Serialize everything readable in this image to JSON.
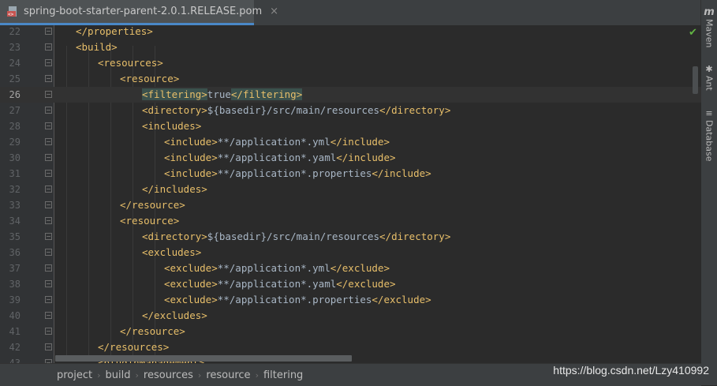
{
  "tab": {
    "title": "spring-boot-starter-parent-2.0.1.RELEASE.pom",
    "close_glyph": "×",
    "icon": "xml-file-icon"
  },
  "right_tools": [
    {
      "label": "Maven",
      "icon": "maven-icon",
      "glyph": "m"
    },
    {
      "label": "Ant",
      "icon": "ant-icon",
      "glyph": "✱"
    },
    {
      "label": "Database",
      "icon": "database-icon",
      "glyph": "≡"
    }
  ],
  "editor": {
    "current_line": 26,
    "lines": [
      {
        "n": "22",
        "indent": 1,
        "parts": [
          {
            "t": "</properties>",
            "k": "tag"
          }
        ]
      },
      {
        "n": "23",
        "indent": 1,
        "parts": [
          {
            "t": "<build>",
            "k": "tag"
          }
        ]
      },
      {
        "n": "24",
        "indent": 2,
        "parts": [
          {
            "t": "<resources>",
            "k": "tag"
          }
        ]
      },
      {
        "n": "25",
        "indent": 3,
        "parts": [
          {
            "t": "<resource>",
            "k": "tag"
          }
        ]
      },
      {
        "n": "26",
        "indent": 4,
        "parts": [
          {
            "t": "<filtering>",
            "k": "tag",
            "hl": true
          },
          {
            "t": "true",
            "k": "text"
          },
          {
            "t": "</filtering>",
            "k": "tag",
            "hl": true
          }
        ]
      },
      {
        "n": "27",
        "indent": 4,
        "parts": [
          {
            "t": "<directory>",
            "k": "tag"
          },
          {
            "t": "${basedir}/src/main/resources",
            "k": "text"
          },
          {
            "t": "</directory>",
            "k": "tag"
          }
        ]
      },
      {
        "n": "28",
        "indent": 4,
        "parts": [
          {
            "t": "<includes>",
            "k": "tag"
          }
        ]
      },
      {
        "n": "29",
        "indent": 5,
        "parts": [
          {
            "t": "<include>",
            "k": "tag"
          },
          {
            "t": "**/application*.yml",
            "k": "text"
          },
          {
            "t": "</include>",
            "k": "tag"
          }
        ]
      },
      {
        "n": "30",
        "indent": 5,
        "parts": [
          {
            "t": "<include>",
            "k": "tag"
          },
          {
            "t": "**/application*.yaml",
            "k": "text"
          },
          {
            "t": "</include>",
            "k": "tag"
          }
        ]
      },
      {
        "n": "31",
        "indent": 5,
        "parts": [
          {
            "t": "<include>",
            "k": "tag"
          },
          {
            "t": "**/application*.properties",
            "k": "text"
          },
          {
            "t": "</include>",
            "k": "tag"
          }
        ]
      },
      {
        "n": "32",
        "indent": 4,
        "parts": [
          {
            "t": "</includes>",
            "k": "tag"
          }
        ]
      },
      {
        "n": "33",
        "indent": 3,
        "parts": [
          {
            "t": "</resource>",
            "k": "tag"
          }
        ]
      },
      {
        "n": "34",
        "indent": 3,
        "parts": [
          {
            "t": "<resource>",
            "k": "tag"
          }
        ]
      },
      {
        "n": "35",
        "indent": 4,
        "parts": [
          {
            "t": "<directory>",
            "k": "tag"
          },
          {
            "t": "${basedir}/src/main/resources",
            "k": "text"
          },
          {
            "t": "</directory>",
            "k": "tag"
          }
        ]
      },
      {
        "n": "36",
        "indent": 4,
        "parts": [
          {
            "t": "<excludes>",
            "k": "tag"
          }
        ]
      },
      {
        "n": "37",
        "indent": 5,
        "parts": [
          {
            "t": "<exclude>",
            "k": "tag"
          },
          {
            "t": "**/application*.yml",
            "k": "text"
          },
          {
            "t": "</exclude>",
            "k": "tag"
          }
        ]
      },
      {
        "n": "38",
        "indent": 5,
        "parts": [
          {
            "t": "<exclude>",
            "k": "tag"
          },
          {
            "t": "**/application*.yaml",
            "k": "text"
          },
          {
            "t": "</exclude>",
            "k": "tag"
          }
        ]
      },
      {
        "n": "39",
        "indent": 5,
        "parts": [
          {
            "t": "<exclude>",
            "k": "tag"
          },
          {
            "t": "**/application*.properties",
            "k": "text"
          },
          {
            "t": "</exclude>",
            "k": "tag"
          }
        ]
      },
      {
        "n": "40",
        "indent": 4,
        "parts": [
          {
            "t": "</excludes>",
            "k": "tag"
          }
        ]
      },
      {
        "n": "41",
        "indent": 3,
        "parts": [
          {
            "t": "</resource>",
            "k": "tag"
          }
        ]
      },
      {
        "n": "42",
        "indent": 2,
        "parts": [
          {
            "t": "</resources>",
            "k": "tag"
          }
        ]
      },
      {
        "n": "43",
        "indent": 2,
        "parts": [
          {
            "t": "<pluginManagement>",
            "k": "tag"
          }
        ]
      }
    ]
  },
  "breadcrumbs": [
    "project",
    "build",
    "resources",
    "resource",
    "filtering"
  ],
  "watermark": "https://blog.csdn.net/Lzy410992",
  "colors": {
    "tag": "#e8bf6a",
    "text": "#a9b7c6",
    "background": "#2b2b2b",
    "tab_accent": "#4a88c7"
  }
}
